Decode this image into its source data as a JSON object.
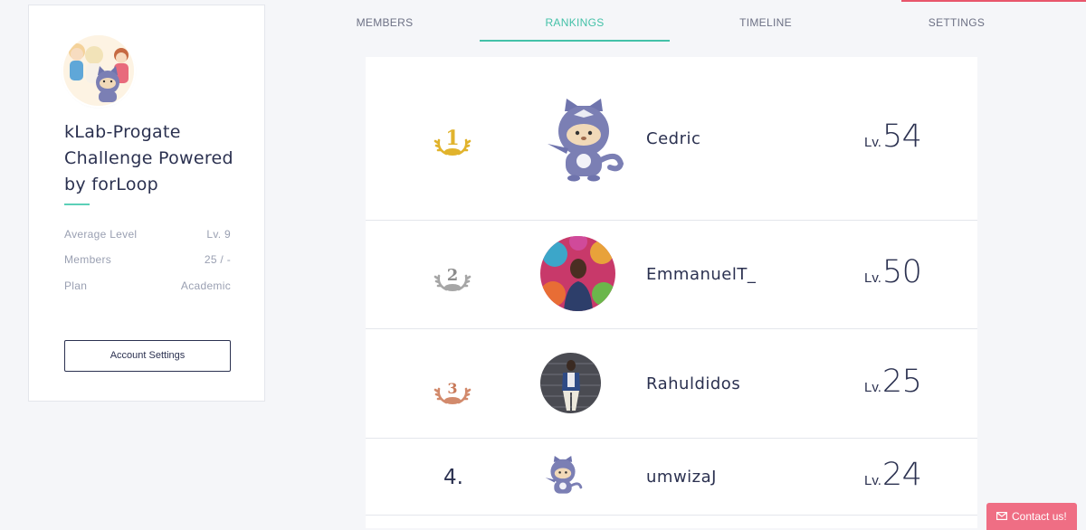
{
  "tabs": [
    {
      "label": "MEMBERS",
      "active": false
    },
    {
      "label": "RANKINGS",
      "active": true
    },
    {
      "label": "TIMELINE",
      "active": false
    },
    {
      "label": "SETTINGS",
      "active": false
    }
  ],
  "group": {
    "name": "kLab-Progate Challenge Powered by forLoop",
    "avatar_icon": "group-illustration",
    "stats": [
      {
        "label": "Average Level",
        "value": "Lv. 9"
      },
      {
        "label": "Members",
        "value": "25 / -"
      },
      {
        "label": "Plan",
        "value": "Academic"
      }
    ],
    "settings_button": "Account Settings"
  },
  "rankings": [
    {
      "rank": "1",
      "medal": "gold",
      "username": "Cedric",
      "lv_prefix": "Lv.",
      "level": "54",
      "avatar": "ninja-mascot"
    },
    {
      "rank": "2",
      "medal": "silver",
      "username": "EmmanuelT_",
      "lv_prefix": "Lv.",
      "level": "50",
      "avatar": "user-photo"
    },
    {
      "rank": "3",
      "medal": "bronze",
      "username": "Rahuldidos",
      "lv_prefix": "Lv.",
      "level": "25",
      "avatar": "user-photo"
    },
    {
      "rank": "4.",
      "medal": "none",
      "username": "umwizaJ",
      "lv_prefix": "Lv.",
      "level": "24",
      "avatar": "ninja-mascot"
    }
  ],
  "colors": {
    "accent": "#44c1a8",
    "gold": "#e1b32c",
    "silver": "#a6a6a6",
    "bronze": "#d28a6c",
    "contact": "#ef6e84",
    "mascot": "#7b7fb4"
  },
  "contact_button": {
    "label": "Contact us!",
    "icon": "mail-icon"
  }
}
